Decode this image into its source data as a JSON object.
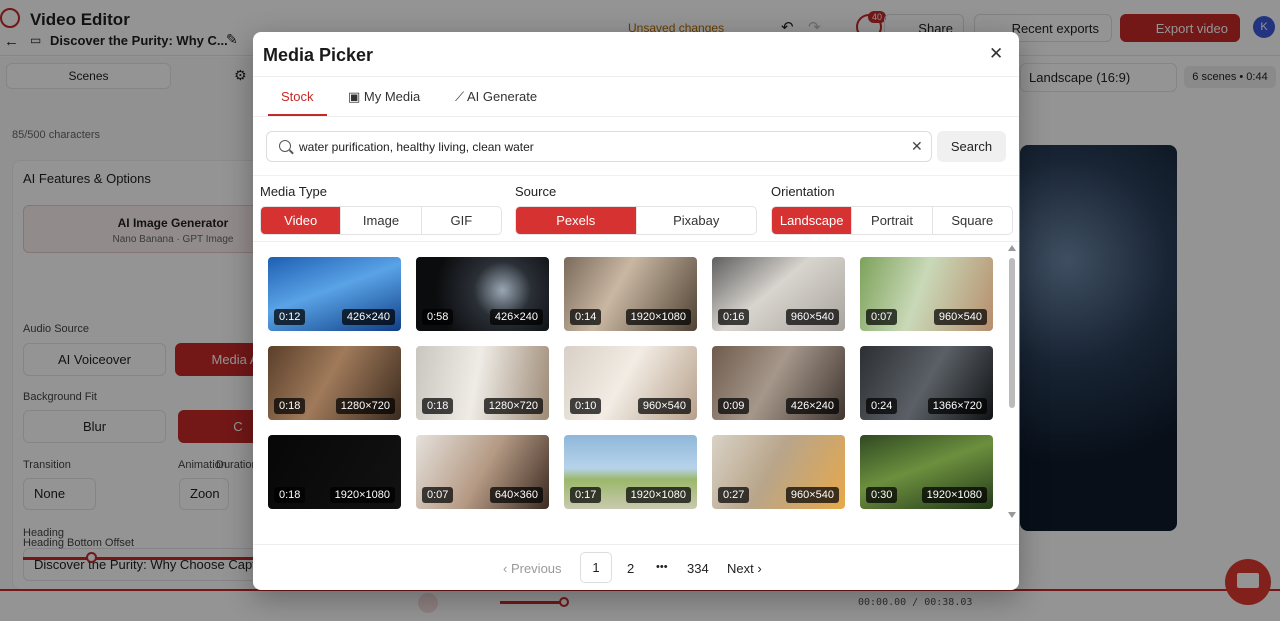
{
  "editor": {
    "app_title": "Video Editor",
    "project_title": "Discover the Purity: Why C...",
    "unsaved": "Unsaved changes",
    "notifications_count": "40",
    "share": "Share",
    "recent_exports": "Recent exports",
    "export_video": "Export video",
    "avatar_initial": "K",
    "tab_scenes": "Scenes",
    "char_count": "85/500 characters",
    "ai_features_title": "AI Features & Options",
    "ai_image_generator": "AI Image Generator",
    "ai_image_generator_sub": "Nano Banana · GPT Image",
    "audio_source_label": "Audio Source",
    "ai_voiceover": "AI Voiceover",
    "media_btn": "Media A",
    "background_fit_label": "Background Fit",
    "blur": "Blur",
    "c_btn": "C",
    "transition_label": "Transition",
    "animation_label": "Animation",
    "duration_label": "Duration",
    "transition_value": "None",
    "zoom_value": "Zoon",
    "heading_label": "Heading",
    "heading_value": "Discover the Purity: Why Choose Capta",
    "heading_offset_label": "Heading Bottom Offset",
    "aspect": "Landscape (16:9)",
    "scenes_info": "6 scenes • 0:44",
    "time": "00:00.00 / 00:38.03"
  },
  "modal": {
    "title": "Media Picker",
    "tabs": [
      {
        "label": "Stock",
        "active": true
      },
      {
        "label": "My Media",
        "active": false
      },
      {
        "label": "AI Generate",
        "active": false
      }
    ],
    "search": {
      "value": "water purification, healthy living, clean water",
      "button": "Search"
    },
    "filters": {
      "media_type": {
        "label": "Media Type",
        "options": [
          "Video",
          "Image",
          "GIF"
        ],
        "selected": "Video"
      },
      "source": {
        "label": "Source",
        "options": [
          "Pexels",
          "Pixabay"
        ],
        "selected": "Pexels"
      },
      "orientation": {
        "label": "Orientation",
        "options": [
          "Landscape",
          "Portrait",
          "Square"
        ],
        "selected": "Landscape"
      }
    },
    "results": [
      {
        "duration": "0:12",
        "resolution": "426×240",
        "bg": "linear-gradient(160deg,#1d5fb3,#5aa3e6 45%,#0f3e86)"
      },
      {
        "duration": "0:58",
        "resolution": "426×240",
        "bg": "radial-gradient(circle at 65% 45%,#9aa7b3 0,#2a2f36 30%,#0b0c0e 70%)"
      },
      {
        "duration": "0:14",
        "resolution": "1920×1080",
        "bg": "linear-gradient(120deg,#7a6a5a,#c9b7a2 40%,#4f4234)"
      },
      {
        "duration": "0:16",
        "resolution": "960×540",
        "bg": "linear-gradient(140deg,#5f5f60,#d8d4ce 45%,#a7a39c)"
      },
      {
        "duration": "0:07",
        "resolution": "960×540",
        "bg": "linear-gradient(110deg,#7da25a,#c9d9b8 45%,#b68d6c)"
      },
      {
        "duration": "0:18",
        "resolution": "1280×720",
        "bg": "linear-gradient(120deg,#5a3f2a,#a07a5a 45%,#3a2a1e)"
      },
      {
        "duration": "0:18",
        "resolution": "1280×720",
        "bg": "linear-gradient(100deg,#c9c6bf,#efece6 45%,#9d8a76)"
      },
      {
        "duration": "0:10",
        "resolution": "960×540",
        "bg": "linear-gradient(120deg,#d8d0c6,#f2ece4 45%,#b6a08a)"
      },
      {
        "duration": "0:09",
        "resolution": "426×240",
        "bg": "linear-gradient(120deg,#6f5b4d,#a5978a 45%,#3f3530)"
      },
      {
        "duration": "0:24",
        "resolution": "1366×720",
        "bg": "linear-gradient(120deg,#2c2f33,#5a6066 50%,#101214)"
      },
      {
        "duration": "0:18",
        "resolution": "1920×1080",
        "bg": "linear-gradient(120deg,#070707,#121212)"
      },
      {
        "duration": "0:07",
        "resolution": "640×360",
        "bg": "linear-gradient(120deg,#e5e1dc,#b59a84 50%,#3b2a22)"
      },
      {
        "duration": "0:17",
        "resolution": "1920×1080",
        "bg": "linear-gradient(180deg,#8fb7d9 0,#b7d3ea 45%,#9bb86a 60%,#c9c9b0)"
      },
      {
        "duration": "0:27",
        "resolution": "960×540",
        "bg": "linear-gradient(120deg,#d9d2c6,#b8a58a 45%,#e7a84a)"
      },
      {
        "duration": "0:30",
        "resolution": "1920×1080",
        "bg": "linear-gradient(160deg,#2f4a22,#6c8f3e 45%,#243a1a)"
      }
    ],
    "pagination": {
      "previous": "Previous",
      "current": "1",
      "page2": "2",
      "ellipsis": "•••",
      "last": "334",
      "next": "Next"
    }
  }
}
